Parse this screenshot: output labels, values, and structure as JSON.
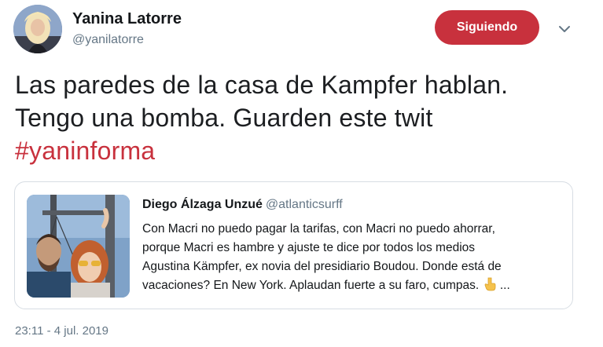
{
  "author": {
    "name": "Yanina Latorre",
    "handle": "@yanilatorre"
  },
  "follow_button": {
    "label": "Siguiendo",
    "color": "#c8313d"
  },
  "tweet": {
    "lines": [
      "Las paredes de la casa de Kampfer hablan.",
      "Tengo una bomba. Guarden este twit"
    ],
    "hashtag": "#yaninforma",
    "hashtag_color": "#c8313d"
  },
  "quoted_tweet": {
    "name": "Diego Álzaga Unzué",
    "handle": "@atlanticsurff",
    "lines": [
      "Con Macri no puedo pagar la tarifas, con Macri no puedo ahorrar,",
      "porque Macri es hambre y ajuste te dice por todos los medios",
      "Agustina Kämpfer, ex novia del presidiario Boudou. Donde está de",
      "vacaciones? En New York. Aplaudan fuerte a su faro, cumpas."
    ],
    "trailing": " ...",
    "emoji_icon": "pointing-down-hand-icon"
  },
  "timestamp": "23:11 - 4 jul. 2019"
}
